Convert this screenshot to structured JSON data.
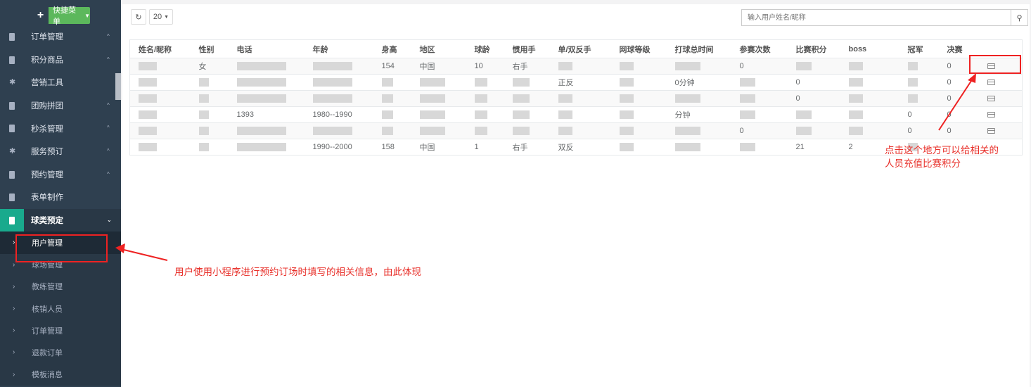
{
  "quick_menu": {
    "label": "快捷菜单"
  },
  "sidebar": {
    "items": [
      {
        "label": "订单管理",
        "chevron": "^"
      },
      {
        "label": "积分商品",
        "chevron": "^"
      },
      {
        "label": "营销工具",
        "chevron": ""
      },
      {
        "label": "团购拼团",
        "chevron": "^"
      },
      {
        "label": "秒杀管理",
        "chevron": "^"
      },
      {
        "label": "服务预订",
        "chevron": "^"
      },
      {
        "label": "预约管理",
        "chevron": "^"
      },
      {
        "label": "表单制作",
        "chevron": ""
      },
      {
        "label": "球类预定",
        "chevron": "⌄"
      }
    ],
    "sub_items": [
      {
        "label": "用户管理"
      },
      {
        "label": "球场管理"
      },
      {
        "label": "教练管理"
      },
      {
        "label": "核销人员"
      },
      {
        "label": "订单管理"
      },
      {
        "label": "退款订单"
      },
      {
        "label": "模板消息"
      }
    ]
  },
  "toolbar": {
    "page_size": "20"
  },
  "search": {
    "placeholder": "输入用户姓名/昵称"
  },
  "table": {
    "headers": [
      "姓名/昵称",
      "性别",
      "电话",
      "年龄",
      "身高",
      "地区",
      "球龄",
      "惯用手",
      "单/双反手",
      "网球等级",
      "打球总时间",
      "参赛次数",
      "比赛积分",
      "boss",
      "冠军",
      "决赛",
      ""
    ],
    "rows": [
      [
        "",
        "女",
        "",
        "",
        "154",
        "中国",
        "10",
        "右手",
        "",
        "",
        "",
        "0",
        "",
        "",
        "",
        "0",
        ""
      ],
      [
        "",
        "",
        "",
        "",
        "",
        "",
        "",
        "",
        "正反",
        "",
        "0分钟",
        "",
        "0",
        "",
        "",
        "0",
        ""
      ],
      [
        "",
        "",
        "",
        "",
        "",
        "",
        "",
        "",
        "",
        "",
        "",
        "",
        "0",
        "",
        "",
        "0",
        ""
      ],
      [
        "",
        "",
        "1393",
        "1980--1990",
        "",
        "",
        "",
        "",
        "",
        "",
        "分钟",
        "",
        "",
        "",
        "0",
        "0",
        ""
      ],
      [
        "",
        "",
        "",
        "",
        "",
        "",
        "",
        "",
        "",
        "",
        "",
        "0",
        "",
        "",
        "0",
        "0",
        ""
      ],
      [
        "",
        "",
        "",
        "1990--2000",
        "158",
        "中国",
        "1",
        "右手",
        "双反",
        "",
        "",
        "",
        "21",
        "2",
        "",
        "",
        ""
      ]
    ]
  },
  "annotations": {
    "recharge_note_line1": "点击这个地方可以给相关的",
    "recharge_note_line2": "人员充值比赛积分",
    "user_note": "用户使用小程序进行预约订场时填写的相关信息，由此体现"
  },
  "colors": {
    "sidebar_bg": "#2f4050",
    "accent_green": "#19aa8d",
    "quick_btn": "#5cb85c",
    "annotation_red": "#e22222"
  }
}
